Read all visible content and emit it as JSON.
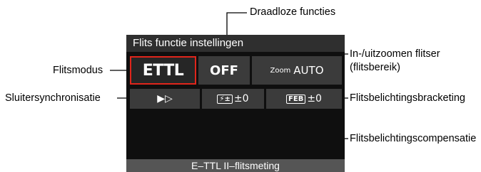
{
  "screen": {
    "title": "Flits functie instellingen",
    "cells": {
      "flash_mode": "ETTL",
      "wireless": "OFF",
      "zoom_small": "Zoom",
      "zoom_value": "AUTO",
      "shutter_sync": "▶▷",
      "fec_icon": "⚡±",
      "fec_value": "±0",
      "feb_icon": "FEB",
      "feb_value": "±0"
    },
    "footer": "E–TTL II–flitsmeting"
  },
  "labels": {
    "draadloze": "Draadloze functies",
    "flitsmodus": "Flitsmodus",
    "zoom_line1": "In-/uitzoomen flitser",
    "zoom_line2": "(flitsbereik)",
    "sluiter": "Sluitersynchronisatie",
    "bracketing": "Flitsbelichtingsbracketing",
    "compensatie": "Flitsbelichtingscompensatie"
  },
  "colors": {
    "selection_border": "#e0251b",
    "screen_bg": "#0f0f0f",
    "cell_bg": "#3b3b3b"
  }
}
